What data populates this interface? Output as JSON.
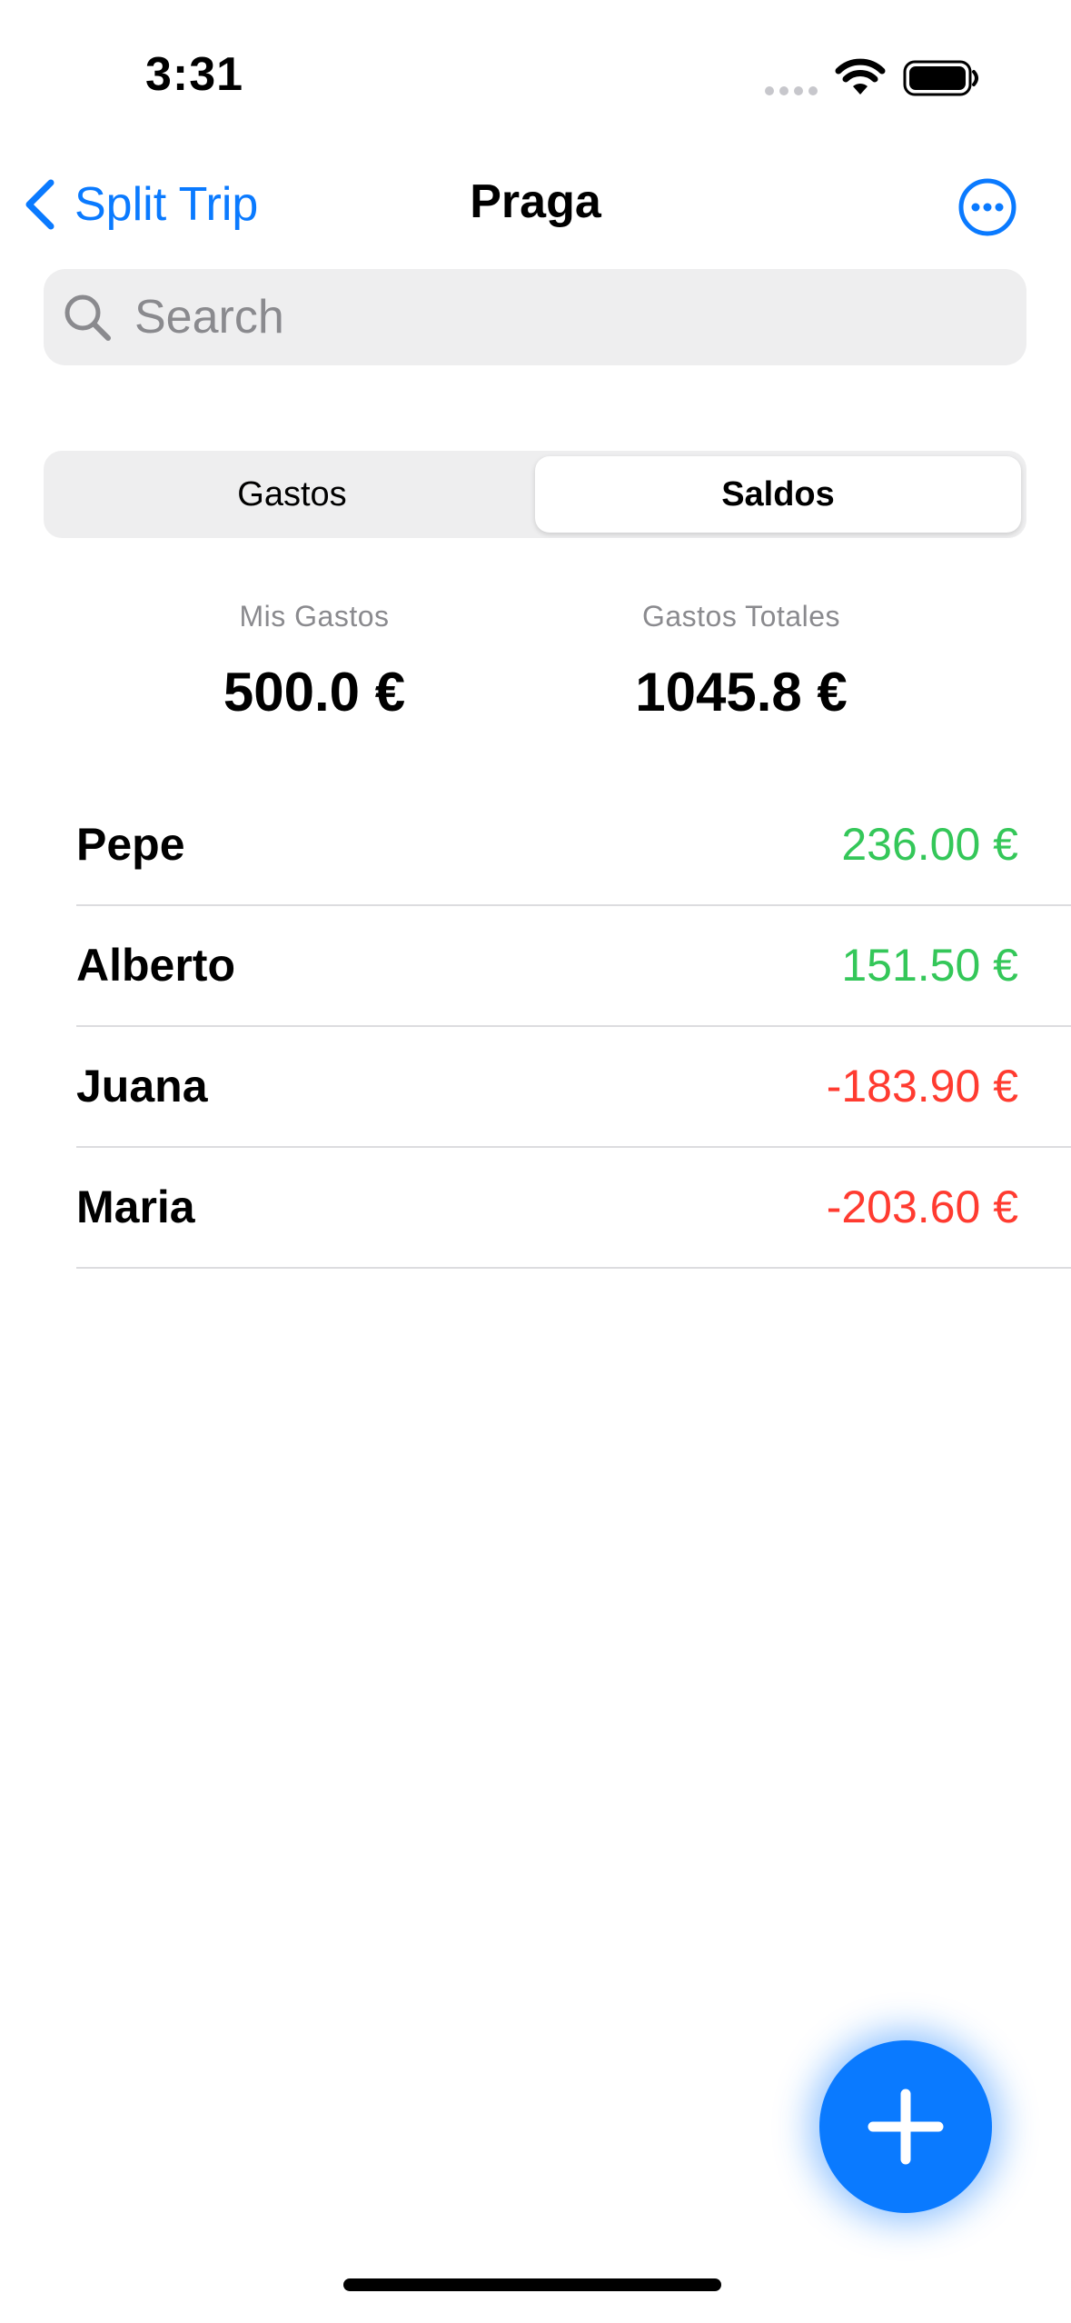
{
  "status_bar": {
    "time": "3:31",
    "icons": [
      "cellular-signal-icon",
      "wifi-icon",
      "battery-icon"
    ]
  },
  "nav": {
    "back_label": "Split Trip",
    "title": "Praga",
    "more_icon": "ellipsis-circle-icon"
  },
  "search": {
    "placeholder": "Search",
    "value": ""
  },
  "segments": {
    "items": [
      "Gastos",
      "Saldos"
    ],
    "selected": "Saldos"
  },
  "summary": {
    "my_label": "Mis Gastos",
    "my_value": "500.0 €",
    "total_label": "Gastos Totales",
    "total_value": "1045.8 €"
  },
  "balances": [
    {
      "name": "Pepe",
      "amount": "236.00 €",
      "status": "positive"
    },
    {
      "name": "Alberto",
      "amount": "151.50 €",
      "status": "positive"
    },
    {
      "name": "Juana",
      "amount": "-183.90 €",
      "status": "negative"
    },
    {
      "name": "Maria",
      "amount": "-203.60 €",
      "status": "negative"
    }
  ],
  "colors": {
    "accent": "#0a7aff",
    "positive": "#34c759",
    "negative": "#ff3b30",
    "secondary_text": "#8a8a8e"
  },
  "fab": {
    "icon": "plus-icon"
  }
}
